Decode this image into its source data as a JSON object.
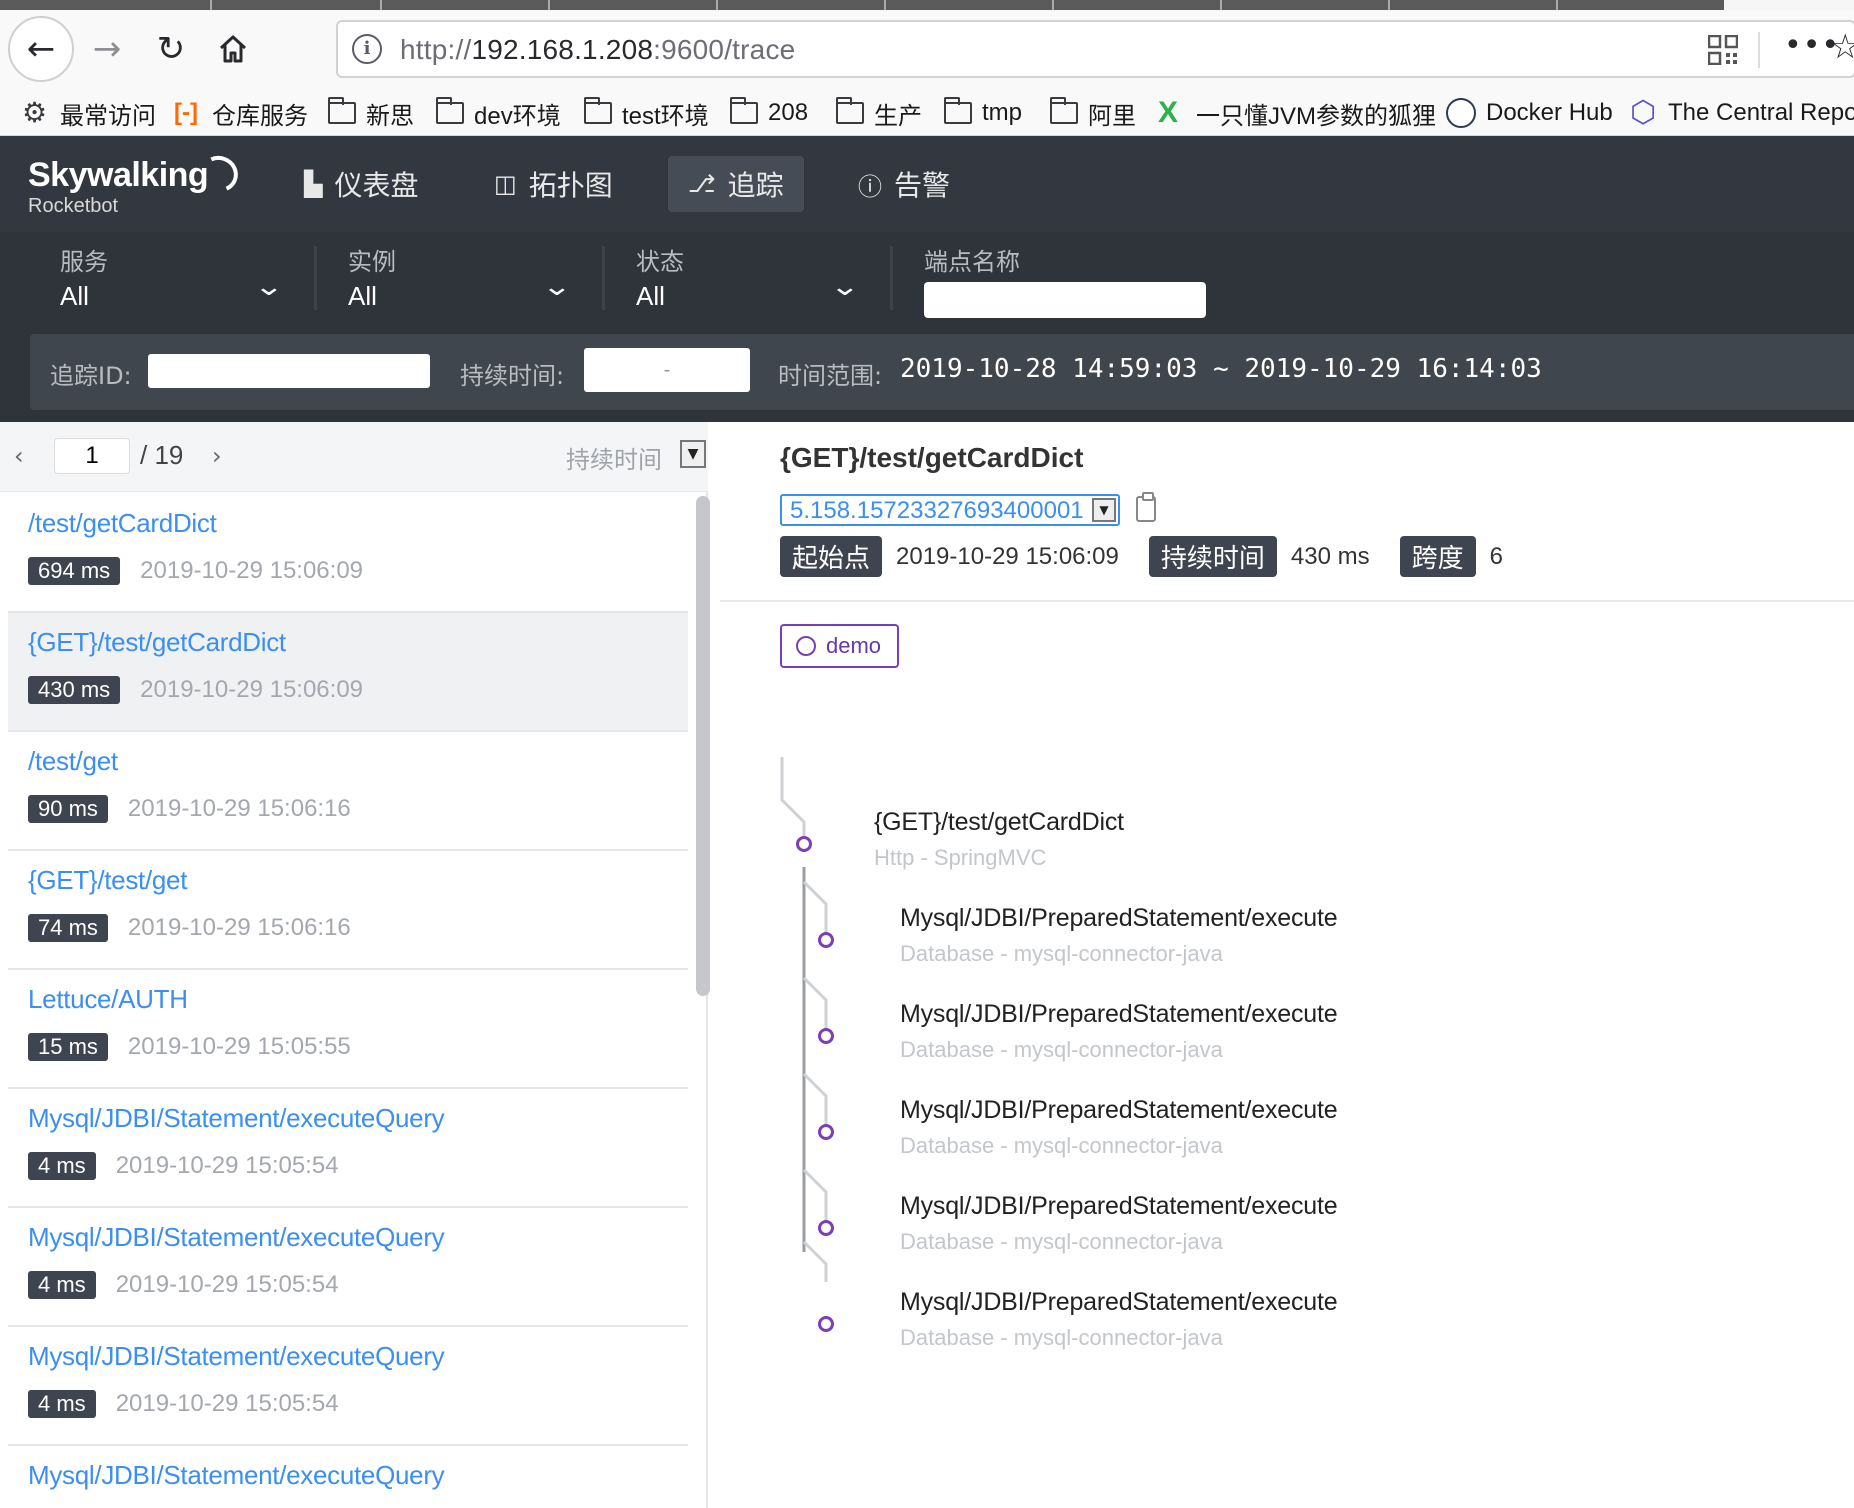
{
  "browser": {
    "url_prefix": "http://",
    "url_host": "192.168.1.208",
    "url_suffix": ":9600/trace",
    "bookmarks": [
      {
        "label": "最常访问",
        "icon": "gear-icon"
      },
      {
        "label": "仓库服务",
        "icon": "aliyun-icon"
      },
      {
        "label": "新思",
        "icon": "folder-icon"
      },
      {
        "label": "dev环境",
        "icon": "folder-icon"
      },
      {
        "label": "test环境",
        "icon": "folder-icon"
      },
      {
        "label": "208",
        "icon": "folder-icon"
      },
      {
        "label": "生产",
        "icon": "folder-icon"
      },
      {
        "label": "tmp",
        "icon": "folder-icon"
      },
      {
        "label": "阿里",
        "icon": "folder-icon"
      },
      {
        "label": "一只懂JVM参数的狐狸",
        "icon": "x-icon"
      },
      {
        "label": "Docker Hub",
        "icon": "docker-icon"
      },
      {
        "label": "The Central Repo",
        "icon": "hexagon-icon"
      }
    ]
  },
  "app": {
    "logo_main": "Skywalking",
    "logo_sub": "Rocketbot",
    "nav": [
      {
        "label": "仪表盘",
        "icon": "chart-icon",
        "active": false
      },
      {
        "label": "拓扑图",
        "icon": "topology-icon",
        "active": false
      },
      {
        "label": "追踪",
        "icon": "trace-icon",
        "active": true
      },
      {
        "label": "告警",
        "icon": "alarm-icon",
        "active": false
      }
    ]
  },
  "filters": {
    "service": {
      "label": "服务",
      "value": "All"
    },
    "instance": {
      "label": "实例",
      "value": "All"
    },
    "status": {
      "label": "状态",
      "value": "All"
    },
    "endpoint": {
      "label": "端点名称",
      "value": ""
    },
    "trace_id_label": "追踪ID:",
    "duration_label": "持续时间:",
    "duration_value": "-",
    "range_label": "时间范围:",
    "range_value": "2019-10-28 14:59:03 ~ 2019-10-29 16:14:03"
  },
  "list": {
    "page": "1",
    "total": "/ 19",
    "sort_label": "持续时间",
    "items": [
      {
        "name": "/test/getCardDict",
        "duration": "694 ms",
        "time": "2019-10-29 15:06:09",
        "selected": false
      },
      {
        "name": "{GET}/test/getCardDict",
        "duration": "430 ms",
        "time": "2019-10-29 15:06:09",
        "selected": true
      },
      {
        "name": "/test/get",
        "duration": "90 ms",
        "time": "2019-10-29 15:06:16",
        "selected": false
      },
      {
        "name": "{GET}/test/get",
        "duration": "74 ms",
        "time": "2019-10-29 15:06:16",
        "selected": false
      },
      {
        "name": "Lettuce/AUTH",
        "duration": "15 ms",
        "time": "2019-10-29 15:05:55",
        "selected": false
      },
      {
        "name": "Mysql/JDBI/Statement/executeQuery",
        "duration": "4 ms",
        "time": "2019-10-29 15:05:54",
        "selected": false
      },
      {
        "name": "Mysql/JDBI/Statement/executeQuery",
        "duration": "4 ms",
        "time": "2019-10-29 15:05:54",
        "selected": false
      },
      {
        "name": "Mysql/JDBI/Statement/executeQuery",
        "duration": "4 ms",
        "time": "2019-10-29 15:05:54",
        "selected": false
      },
      {
        "name": "Mysql/JDBI/Statement/executeQuery",
        "duration": "",
        "time": "",
        "selected": false
      }
    ]
  },
  "detail": {
    "title": "{GET}/test/getCardDict",
    "trace_id": "5.158.15723327693400001",
    "start_label": "起始点",
    "start_value": "2019-10-29 15:06:09",
    "duration_label": "持续时间",
    "duration_value": "430 ms",
    "spans_label": "跨度",
    "spans_value": "6",
    "service": "demo",
    "spans": [
      {
        "name": "{GET}/test/getCardDict",
        "type": "Http - SpringMVC",
        "level": 0
      },
      {
        "name": "Mysql/JDBI/PreparedStatement/execute",
        "type": "Database - mysql-connector-java",
        "level": 1
      },
      {
        "name": "Mysql/JDBI/PreparedStatement/execute",
        "type": "Database - mysql-connector-java",
        "level": 1
      },
      {
        "name": "Mysql/JDBI/PreparedStatement/execute",
        "type": "Database - mysql-connector-java",
        "level": 1
      },
      {
        "name": "Mysql/JDBI/PreparedStatement/execute",
        "type": "Database - mysql-connector-java",
        "level": 1
      },
      {
        "name": "Mysql/JDBI/PreparedStatement/execute",
        "type": "Database - mysql-connector-java",
        "level": 1
      }
    ]
  }
}
